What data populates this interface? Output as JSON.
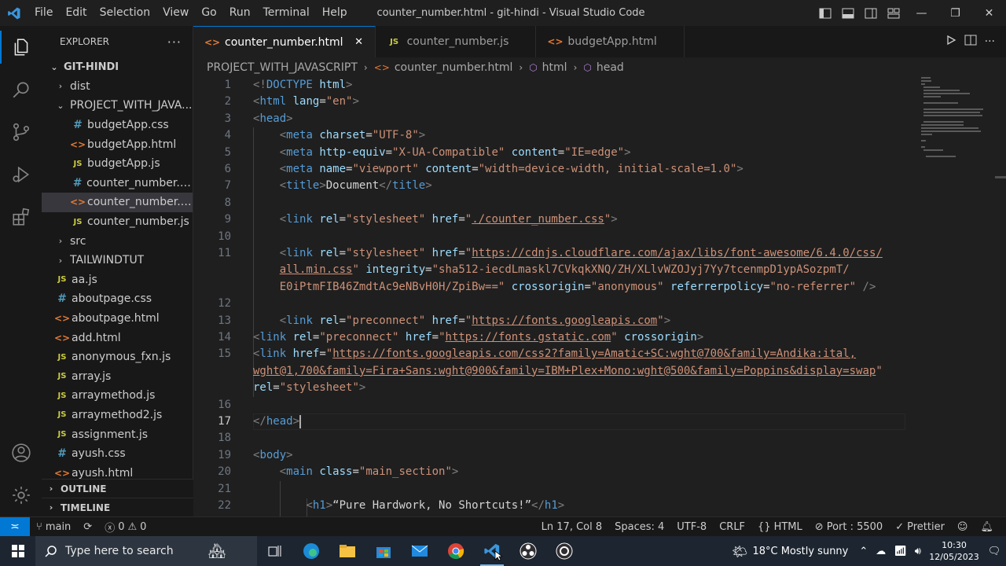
{
  "menu": [
    "File",
    "Edit",
    "Selection",
    "View",
    "Go",
    "Run",
    "Terminal",
    "Help"
  ],
  "window_title": "counter_number.html - git-hindi - Visual Studio Code",
  "sidebar": {
    "header": "EXPLORER",
    "root": "GIT-HINDI",
    "items": [
      {
        "label": "dist",
        "kind": "folder",
        "depth": 1,
        "chev": "›"
      },
      {
        "label": "PROJECT_WITH_JAVA...",
        "kind": "folder",
        "depth": 1,
        "chev": "⌄"
      },
      {
        "label": "budgetApp.css",
        "kind": "css",
        "depth": 2
      },
      {
        "label": "budgetApp.html",
        "kind": "html",
        "depth": 2
      },
      {
        "label": "budgetApp.js",
        "kind": "js",
        "depth": 2
      },
      {
        "label": "counter_number.css",
        "kind": "css",
        "depth": 2
      },
      {
        "label": "counter_number.html",
        "kind": "html",
        "depth": 2,
        "selected": true
      },
      {
        "label": "counter_number.js",
        "kind": "js",
        "depth": 2
      },
      {
        "label": "src",
        "kind": "folder",
        "depth": 1,
        "chev": "›"
      },
      {
        "label": "TAILWINDTUT",
        "kind": "folder",
        "depth": 1,
        "chev": "›"
      },
      {
        "label": "aa.js",
        "kind": "js",
        "depth": 1
      },
      {
        "label": "aboutpage.css",
        "kind": "css",
        "depth": 1
      },
      {
        "label": "aboutpage.html",
        "kind": "html",
        "depth": 1
      },
      {
        "label": "add.html",
        "kind": "html",
        "depth": 1
      },
      {
        "label": "anonymous_fxn.js",
        "kind": "js",
        "depth": 1
      },
      {
        "label": "array.js",
        "kind": "js",
        "depth": 1
      },
      {
        "label": "arraymethod.js",
        "kind": "js",
        "depth": 1
      },
      {
        "label": "arraymethod2.js",
        "kind": "js",
        "depth": 1
      },
      {
        "label": "assignment.js",
        "kind": "js",
        "depth": 1
      },
      {
        "label": "ayush.css",
        "kind": "css",
        "depth": 1
      },
      {
        "label": "ayush.html",
        "kind": "html",
        "depth": 1
      }
    ],
    "outline": "OUTLINE",
    "timeline": "TIMELINE"
  },
  "tabs": [
    {
      "label": "counter_number.html",
      "kind": "html",
      "active": true
    },
    {
      "label": "counter_number.js",
      "kind": "js"
    },
    {
      "label": "budgetApp.html",
      "kind": "html"
    }
  ],
  "breadcrumb": {
    "folder": "PROJECT_WITH_JAVASCRIPT",
    "file": "counter_number.html",
    "el1": "html",
    "el2": "head"
  },
  "code": [
    {
      "n": "1",
      "html": "<span class='t'>&lt;!</span><span class='tg'>DOCTYPE</span> <span class='at'>html</span><span class='t'>&gt;</span>"
    },
    {
      "n": "2",
      "html": "<span class='t'>&lt;</span><span class='tg'>html</span> <span class='at'>lang</span><span class='tx'>=</span><span class='sv'>\"en\"</span><span class='t'>&gt;</span>"
    },
    {
      "n": "3",
      "html": "<span class='t'>&lt;</span><span class='tg'>head</span><span class='t'>&gt;</span>"
    },
    {
      "n": "4",
      "html": "    <span class='t'>&lt;</span><span class='tg'>meta</span> <span class='at'>charset</span><span class='tx'>=</span><span class='sv'>\"UTF-8\"</span><span class='t'>&gt;</span>"
    },
    {
      "n": "5",
      "html": "    <span class='t'>&lt;</span><span class='tg'>meta</span> <span class='at'>http-equiv</span><span class='tx'>=</span><span class='sv'>\"X-UA-Compatible\"</span> <span class='at'>content</span><span class='tx'>=</span><span class='sv'>\"IE=edge\"</span><span class='t'>&gt;</span>"
    },
    {
      "n": "6",
      "html": "    <span class='t'>&lt;</span><span class='tg'>meta</span> <span class='at'>name</span><span class='tx'>=</span><span class='sv'>\"viewport\"</span> <span class='at'>content</span><span class='tx'>=</span><span class='sv'>\"width=device-width, initial-scale=1.0\"</span><span class='t'>&gt;</span>"
    },
    {
      "n": "7",
      "html": "    <span class='t'>&lt;</span><span class='tg'>title</span><span class='t'>&gt;</span><span class='tx'>Document</span><span class='t'>&lt;/</span><span class='tg'>title</span><span class='t'>&gt;</span>"
    },
    {
      "n": "8",
      "html": ""
    },
    {
      "n": "9",
      "html": "    <span class='t'>&lt;</span><span class='tg'>link</span> <span class='at'>rel</span><span class='tx'>=</span><span class='sv'>\"stylesheet\"</span> <span class='at'>href</span><span class='tx'>=</span><span class='sv'>\"<span class='link'>./counter_number.css</span>\"</span><span class='t'>&gt;</span>"
    },
    {
      "n": "10",
      "html": ""
    },
    {
      "n": "11",
      "html": "    <span class='t'>&lt;</span><span class='tg'>link</span> <span class='at'>rel</span><span class='tx'>=</span><span class='sv'>\"stylesheet\"</span> <span class='at'>href</span><span class='tx'>=</span><span class='sv'>\"<span class='link'>https://cdnjs.cloudflare.com/ajax/libs/font-awesome/6.4.0/css/</span></span>"
    },
    {
      "n": "",
      "html": "    <span class='sv'><span class='link'>all.min.css</span>\"</span> <span class='at'>integrity</span><span class='tx'>=</span><span class='sv'>\"sha512-iecdLmaskl7CVkqkXNQ/ZH/XLlvWZOJyj7Yy7tcenmpD1ypASozpmT/</span>"
    },
    {
      "n": "",
      "html": "    <span class='sv'>E0iPtmFIB46ZmdtAc9eNBvH0H/ZpiBw==\"</span> <span class='at'>crossorigin</span><span class='tx'>=</span><span class='sv'>\"anonymous\"</span> <span class='at'>referrerpolicy</span><span class='tx'>=</span><span class='sv'>\"no-referrer\"</span> <span class='t'>/&gt;</span>"
    },
    {
      "n": "12",
      "html": ""
    },
    {
      "n": "13",
      "html": "    <span class='t'>&lt;</span><span class='tg'>link</span> <span class='at'>rel</span><span class='tx'>=</span><span class='sv'>\"preconnect\"</span> <span class='at'>href</span><span class='tx'>=</span><span class='sv'>\"<span class='link'>https://fonts.googleapis.com</span>\"</span><span class='t'>&gt;</span>"
    },
    {
      "n": "14",
      "html": "<span class='t'>&lt;</span><span class='tg'>link</span> <span class='at'>rel</span><span class='tx'>=</span><span class='sv'>\"preconnect\"</span> <span class='at'>href</span><span class='tx'>=</span><span class='sv'>\"<span class='link'>https://fonts.gstatic.com</span>\"</span> <span class='at'>crossorigin</span><span class='t'>&gt;</span>"
    },
    {
      "n": "15",
      "html": "<span class='t'>&lt;</span><span class='tg'>link</span> <span class='at'>href</span><span class='tx'>=</span><span class='sv'>\"<span class='link'>https://fonts.googleapis.com/css2?family=Amatic+SC:wght@700&amp;family=Andika:ital,</span></span>"
    },
    {
      "n": "",
      "html": "<span class='sv'><span class='link'>wght@1,700&amp;family=Fira+Sans:wght@900&amp;family=IBM+Plex+Mono:wght@500&amp;family=Poppins&amp;display=swap</span>\"</span>"
    },
    {
      "n": "",
      "html": "<span class='at'>rel</span><span class='tx'>=</span><span class='sv'>\"stylesheet\"</span><span class='t'>&gt;</span>"
    },
    {
      "n": "16",
      "html": ""
    },
    {
      "n": "17",
      "html": "<span class='t'>&lt;/</span><span class='tg'>head</span><span class='t'>&gt;</span><span class='caret'></span>",
      "current": true
    },
    {
      "n": "18",
      "html": ""
    },
    {
      "n": "19",
      "html": "<span class='t'>&lt;</span><span class='tg'>body</span><span class='t'>&gt;</span>"
    },
    {
      "n": "20",
      "html": "    <span class='t'>&lt;</span><span class='tg'>main</span> <span class='at'>class</span><span class='tx'>=</span><span class='sv'>\"main_section\"</span><span class='t'>&gt;</span>"
    },
    {
      "n": "21",
      "html": ""
    },
    {
      "n": "22",
      "html": "        <span class='t'>&lt;</span><span class='tg'>h1</span><span class='t'>&gt;</span><span class='tx'>“Pure Hardwork, No Shortcuts!”</span><span class='t'>&lt;/</span><span class='tg'>h1</span><span class='t'>&gt;</span>"
    }
  ],
  "status": {
    "branch": "main",
    "errors": "0",
    "warnings": "0",
    "position": "Ln 17, Col 8",
    "spaces": "Spaces: 4",
    "encoding": "UTF-8",
    "eol": "CRLF",
    "language": "HTML",
    "port": "Port : 5500",
    "prettier": "Prettier"
  },
  "taskbar": {
    "search_placeholder": "Type here to search",
    "weather": "18°C  Mostly sunny",
    "time": "10:30",
    "date": "12/05/2023"
  },
  "colors": {
    "accent": "#0078d4",
    "tag": "#569cd6",
    "attr": "#9cdcfe",
    "string": "#ce9178"
  }
}
